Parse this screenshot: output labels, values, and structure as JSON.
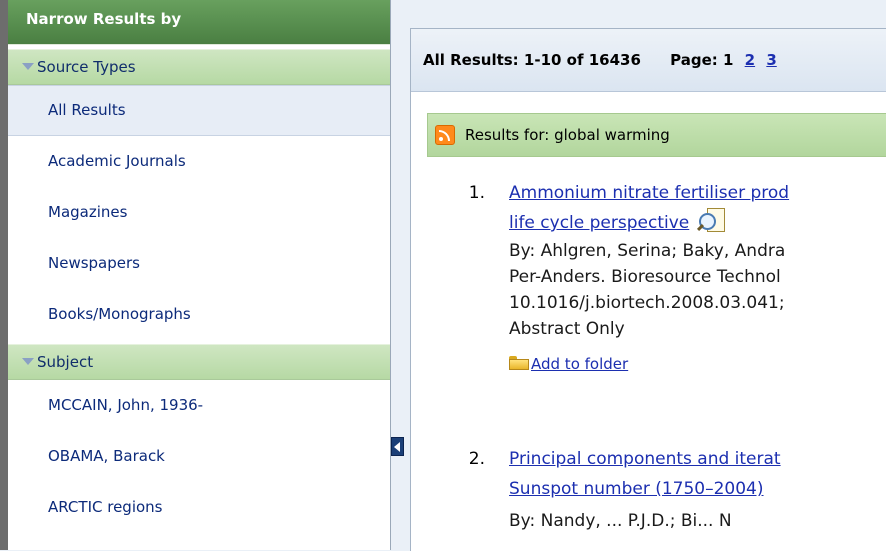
{
  "sidebar": {
    "title": "Narrow Results by",
    "sections": [
      {
        "label": "Source Types",
        "items": [
          "All Results",
          "Academic Journals",
          "Magazines",
          "Newspapers",
          "Books/Monographs"
        ]
      },
      {
        "label": "Subject",
        "items": [
          "MCCAIN, John, 1936-",
          "OBAMA, Barack",
          "ARCTIC regions"
        ]
      }
    ]
  },
  "results_bar": {
    "summary": "All Results: 1-10 of 16436",
    "page_label": "Page: 1",
    "page_links": [
      "2",
      "3"
    ]
  },
  "results_for": {
    "label": "Results for:  global warming",
    "icon": "rss-feed-icon"
  },
  "results": [
    {
      "num": "1.",
      "title_line1": "Ammonium nitrate fertiliser prod",
      "title_line2": "life cycle perspective",
      "meta": [
        "By: Ahlgren, Serina; Baky, Andra",
        "Per-Anders. Bioresource Technol",
        "10.1016/j.biortech.2008.03.041;",
        "Abstract Only"
      ],
      "folder_label": "Add to folder"
    },
    {
      "num": "2.",
      "title_line1": "Principal components and iterat",
      "title_line2": "Sunspot number (1750–2004)",
      "meta_partial": "By: Nandy, ... P.J.D.; Bi... N"
    }
  ],
  "colors": {
    "sidebar_header": "#4f8646",
    "section_head": "#c0dfae",
    "link": "#1c2fb0",
    "selected_bg": "#e7edf6"
  }
}
